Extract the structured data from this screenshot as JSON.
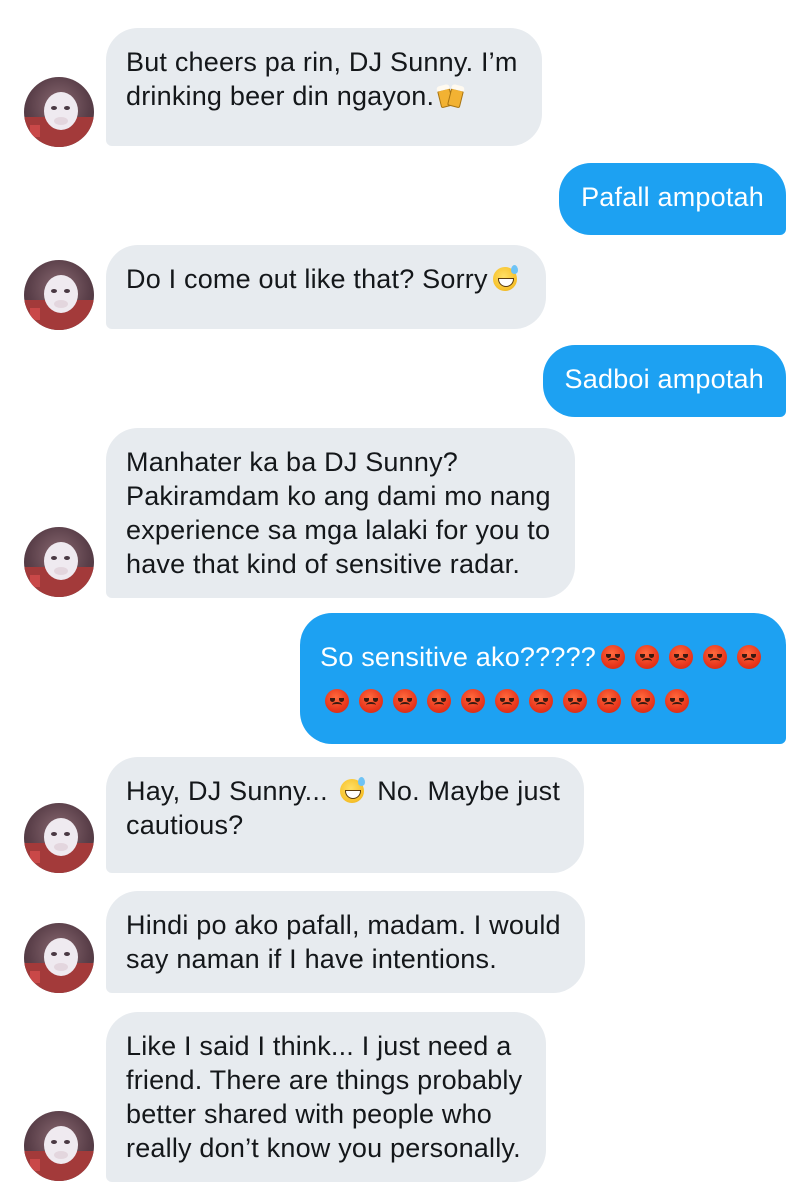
{
  "conversation": {
    "messages": [
      {
        "sender": "other",
        "lines": [
          "But cheers pa rin, DJ Sunny. I’m",
          "drinking beer din ngayon."
        ],
        "emoji": "beer-mugs-icon"
      },
      {
        "sender": "me",
        "lines": [
          "Pafall ampotah"
        ]
      },
      {
        "sender": "other",
        "lines": [
          "Do I come out like that? Sorry"
        ],
        "emoji": "grinning-sweat-face-icon"
      },
      {
        "sender": "me",
        "lines": [
          "Sadboi ampotah"
        ]
      },
      {
        "sender": "other",
        "lines": [
          "Manhater ka ba DJ Sunny?",
          "Pakiramdam ko ang dami mo nang",
          "experience sa mga lalaki for you to",
          "have that kind of sensitive radar."
        ]
      },
      {
        "sender": "me",
        "lines": [
          "So sensitive ako?????"
        ],
        "emoji": "angry-face-icon",
        "emoji_count": 16
      },
      {
        "sender": "other",
        "lines": [
          "Hay, DJ Sunny...",
          "No. Maybe just",
          "cautious?"
        ],
        "emoji": "grinning-sweat-face-icon"
      },
      {
        "sender": "other",
        "lines": [
          "Hindi po ako pafall, madam. I would",
          "say naman if I have intentions."
        ]
      },
      {
        "sender": "other",
        "lines": [
          "Like I said I think... I just need a",
          "friend. There are things probably",
          "better shared with people who",
          "really don’t know you personally."
        ]
      }
    ]
  },
  "colors": {
    "incoming_bubble": "#e7ebef",
    "outgoing_bubble": "#1da1f2",
    "incoming_text": "#14171a",
    "outgoing_text": "#ffffff"
  }
}
